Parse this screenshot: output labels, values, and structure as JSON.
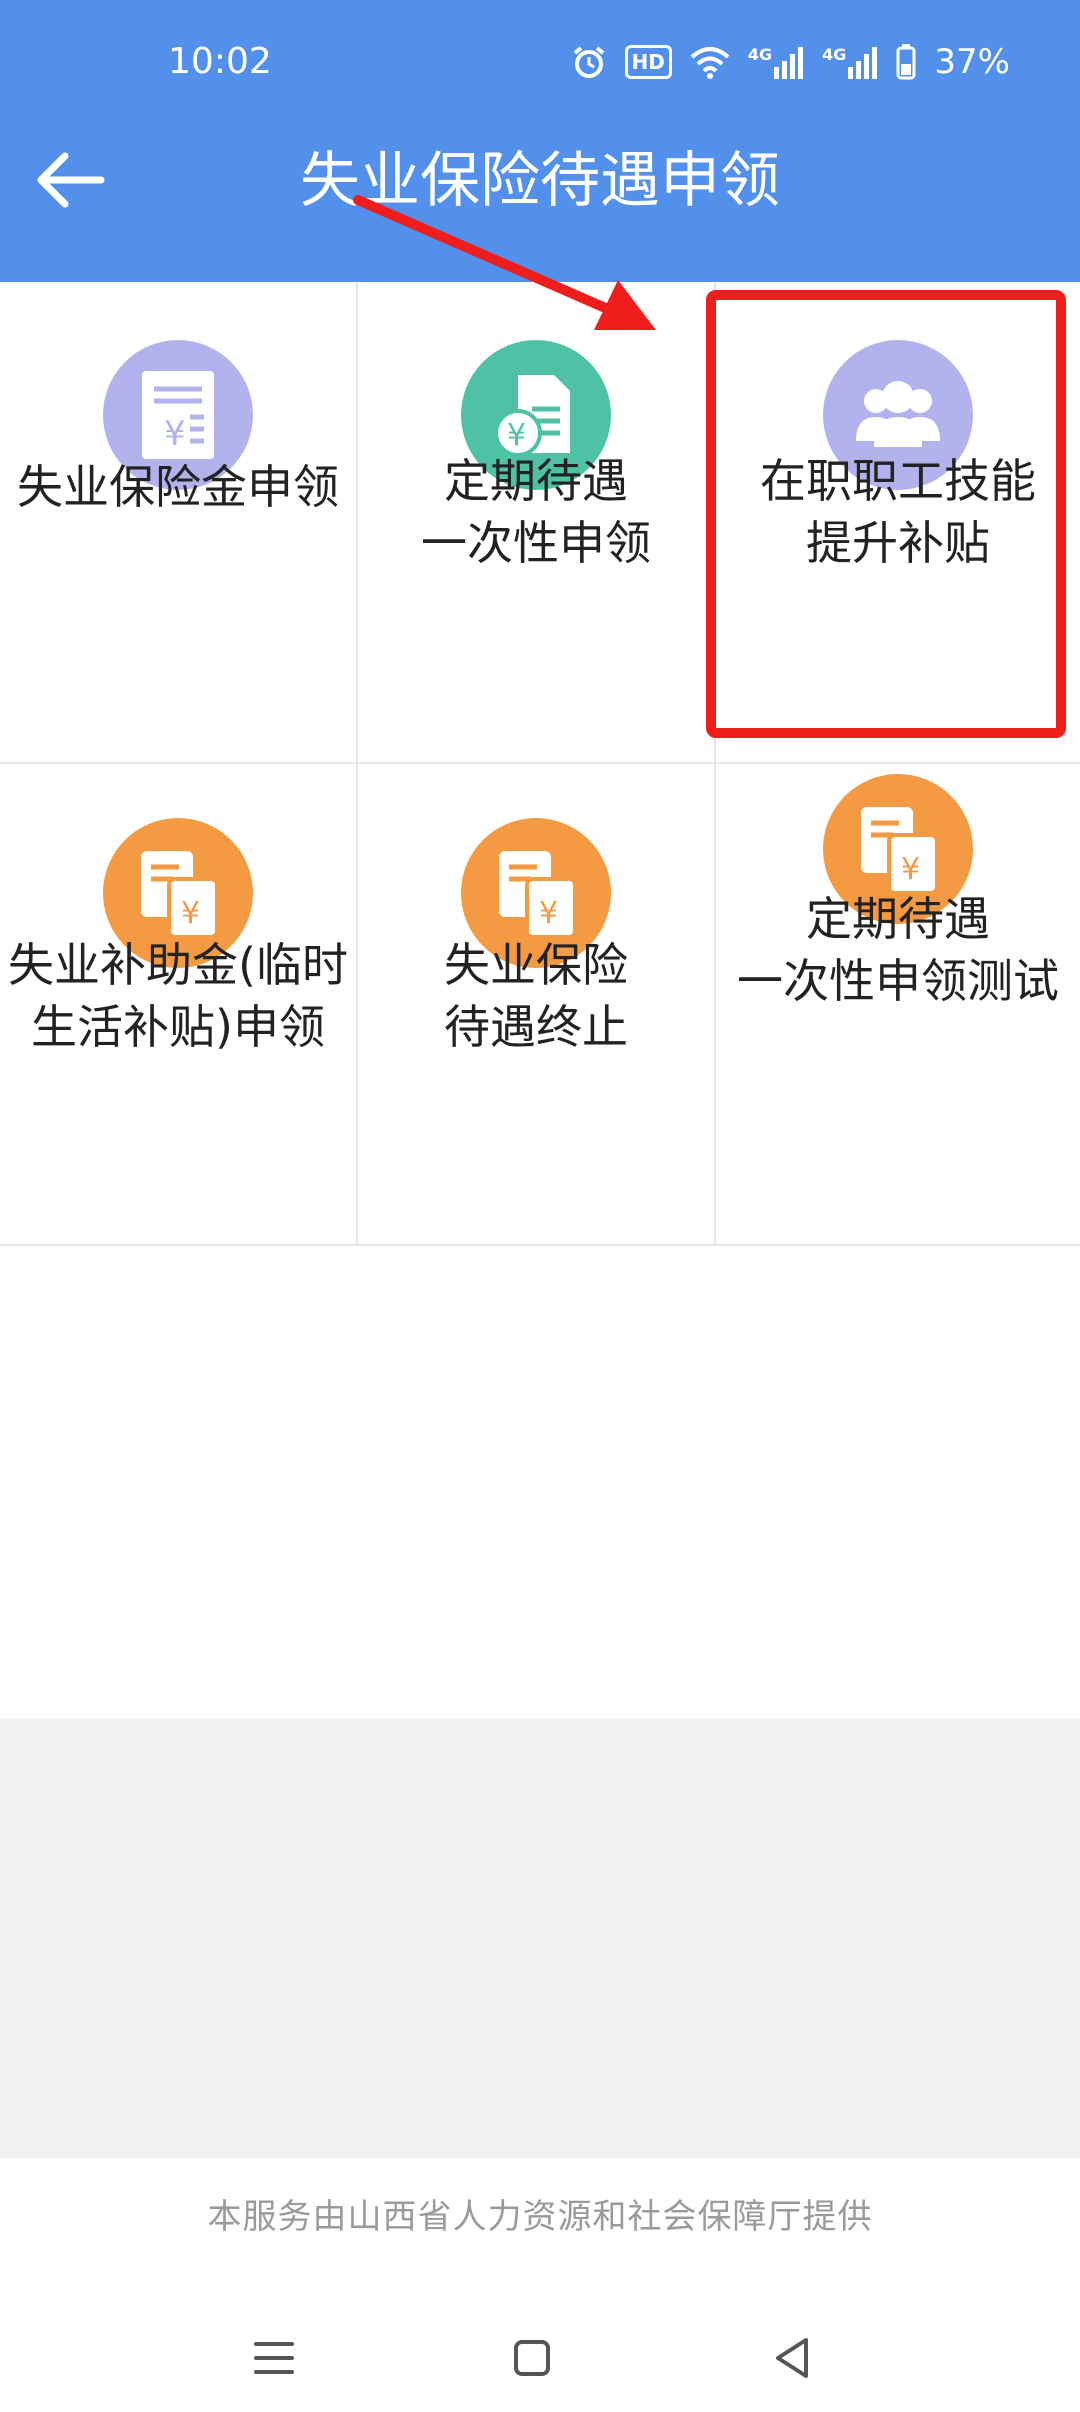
{
  "status_bar": {
    "time": "10:02",
    "hd_label": "HD",
    "network_label_1": "4G",
    "network_label_2": "4G",
    "battery": "37%"
  },
  "header": {
    "title": "失业保险待遇申领",
    "back_icon": "arrow-left-icon",
    "color": "#5390ec"
  },
  "services": [
    {
      "label": "失业保险金申领",
      "icon": "receipt-yen-icon",
      "color": "#b2b3ec"
    },
    {
      "label": "定期待遇\n一次性申领",
      "icon": "money-document-icon",
      "color": "#4fc2a6"
    },
    {
      "label": "在职职工技能\n提升补贴",
      "icon": "users-icon",
      "color": "#b2b3ec"
    },
    {
      "label": "失业补助金(临时\n生活补贴)申领",
      "icon": "documents-yen-icon",
      "color": "#f39a42"
    },
    {
      "label": "失业保险\n待遇终止",
      "icon": "documents-yen-icon",
      "color": "#f39a42"
    },
    {
      "label": "定期待遇\n一次性申领测试",
      "icon": "documents-yen-icon",
      "color": "#f39a42"
    }
  ],
  "annotation": {
    "highlighted_item": "在职职工技能\n提升补贴",
    "color": "#f01d1d"
  },
  "footer": {
    "provider_text": "本服务由山西省人力资源和社会保障厅提供"
  },
  "nav_bar": {
    "menu_icon": "menu-icon",
    "home_icon": "square-home-icon",
    "back_icon": "triangle-back-icon"
  }
}
